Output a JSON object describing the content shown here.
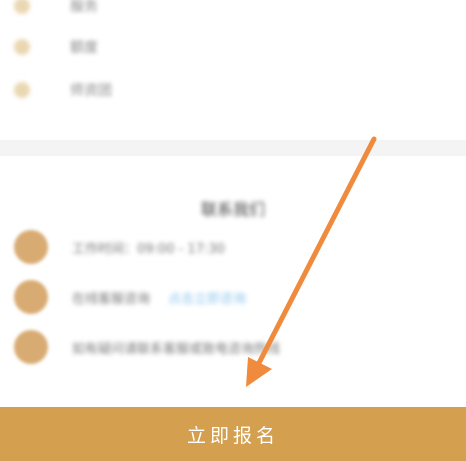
{
  "features": {
    "items": [
      {
        "label": "服务"
      },
      {
        "label": "额度"
      },
      {
        "label": "师资团"
      }
    ]
  },
  "contact": {
    "title": "联系我们",
    "rows": [
      {
        "text": "工作时间：09:00 - 17:30",
        "link": ""
      },
      {
        "text": "在线客服咨询",
        "link": "点击立即咨询"
      },
      {
        "text": "如有疑问请联系客服或致电咨询热线",
        "link": ""
      }
    ]
  },
  "cta": {
    "label": "立即报名"
  },
  "colors": {
    "accent": "#d4a050",
    "icon": "#d8ab72",
    "annotation_arrow": "#f08a3c"
  }
}
